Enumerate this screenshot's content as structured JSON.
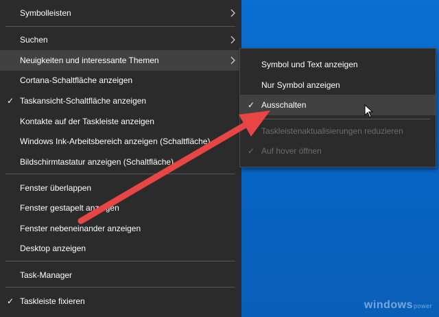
{
  "menu": {
    "items": [
      {
        "label": "Symbolleisten",
        "checked": false,
        "submenu": true
      },
      {
        "label": "Suchen",
        "checked": false,
        "submenu": true
      },
      {
        "label": "Neuigkeiten und interessante Themen",
        "checked": false,
        "submenu": true,
        "highlighted": true
      },
      {
        "label": "Cortana-Schaltfläche anzeigen",
        "checked": false,
        "submenu": false
      },
      {
        "label": "Taskansicht-Schaltfläche anzeigen",
        "checked": true,
        "submenu": false
      },
      {
        "label": "Kontakte auf der Taskleiste anzeigen",
        "checked": false,
        "submenu": false
      },
      {
        "label": "Windows Ink-Arbeitsbereich anzeigen (Schaltfläche)",
        "checked": false,
        "submenu": false
      },
      {
        "label": "Bildschirmtastatur anzeigen (Schaltfläche)",
        "checked": false,
        "submenu": false
      },
      {
        "label": "Fenster überlappen",
        "checked": false,
        "submenu": false
      },
      {
        "label": "Fenster gestapelt anzeigen",
        "checked": false,
        "submenu": false
      },
      {
        "label": "Fenster nebeneinander anzeigen",
        "checked": false,
        "submenu": false
      },
      {
        "label": "Desktop anzeigen",
        "checked": false,
        "submenu": false
      },
      {
        "label": "Task-Manager",
        "checked": false,
        "submenu": false
      },
      {
        "label": "Taskleiste fixieren",
        "checked": true,
        "submenu": false
      }
    ]
  },
  "submenu": {
    "items": [
      {
        "label": "Symbol und Text anzeigen",
        "checked": false,
        "disabled": false
      },
      {
        "label": "Nur Symbol anzeigen",
        "checked": false,
        "disabled": false
      },
      {
        "label": "Ausschalten",
        "checked": true,
        "disabled": false,
        "highlighted": true
      },
      {
        "label": "Taskleistenaktualisierungen reduzieren",
        "checked": false,
        "disabled": true
      },
      {
        "label": "Auf hover öffnen",
        "checked": true,
        "disabled": true
      }
    ]
  },
  "glyphs": {
    "check": "✓"
  },
  "watermark": {
    "brand": "windows",
    "suffix": "power"
  },
  "colors": {
    "menu_bg": "#2b2b2b",
    "highlight": "#414141",
    "desktop": "#0a6fd1",
    "arrow": "#e84545",
    "disabled_text": "#6d6d6d"
  }
}
